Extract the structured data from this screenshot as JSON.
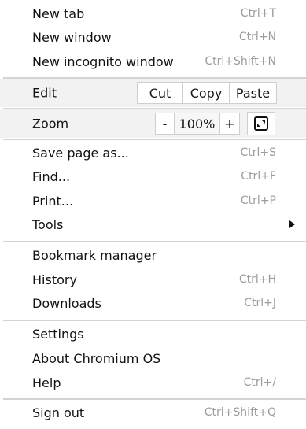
{
  "menu": {
    "new_tab": {
      "label": "New tab",
      "shortcut": "Ctrl+T"
    },
    "new_window": {
      "label": "New window",
      "shortcut": "Ctrl+N"
    },
    "new_incognito": {
      "label": "New incognito window",
      "shortcut": "Ctrl+Shift+N"
    },
    "edit": {
      "label": "Edit",
      "cut": "Cut",
      "copy": "Copy",
      "paste": "Paste"
    },
    "zoom": {
      "label": "Zoom",
      "minus": "-",
      "value": "100%",
      "plus": "+",
      "fullscreen_icon": "fullscreen-icon"
    },
    "save_page": {
      "label": "Save page as...",
      "shortcut": "Ctrl+S"
    },
    "find": {
      "label": "Find...",
      "shortcut": "Ctrl+F"
    },
    "print": {
      "label": "Print...",
      "shortcut": "Ctrl+P"
    },
    "tools": {
      "label": "Tools",
      "submenu_icon": "submenu-arrow-icon"
    },
    "bookmark_manager": {
      "label": "Bookmark manager"
    },
    "history": {
      "label": "History",
      "shortcut": "Ctrl+H"
    },
    "downloads": {
      "label": "Downloads",
      "shortcut": "Ctrl+J"
    },
    "settings": {
      "label": "Settings"
    },
    "about": {
      "label": "About Chromium OS"
    },
    "help": {
      "label": "Help",
      "shortcut": "Ctrl+/"
    },
    "sign_out": {
      "label": "Sign out",
      "shortcut": "Ctrl+Shift+Q"
    }
  },
  "colors": {
    "background": "#ffffff",
    "band_background": "#f2f2f2",
    "separator": "#d4d4d4",
    "shortcut_text": "#9c9c9c",
    "label_text": "#121212"
  }
}
